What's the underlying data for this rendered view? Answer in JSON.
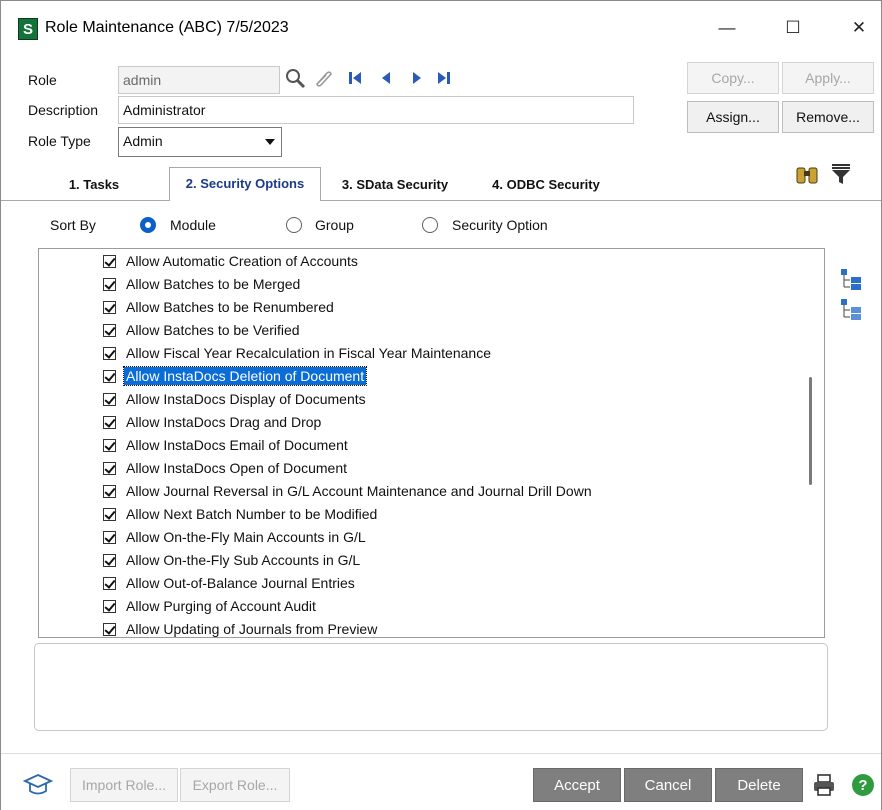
{
  "window": {
    "logo_letter": "S",
    "title": "Role Maintenance (ABC) 7/5/2023",
    "minimize": "—",
    "maximize": "☐",
    "close": "✕"
  },
  "form": {
    "role_label": "Role",
    "role_value": "admin",
    "description_label": "Description",
    "description_value": "Administrator",
    "role_type_label": "Role Type",
    "role_type_value": "Admin"
  },
  "buttons": {
    "copy": "Copy...",
    "apply": "Apply...",
    "assign": "Assign...",
    "remove": "Remove..."
  },
  "tabs": [
    {
      "label": "1. Tasks",
      "active": false
    },
    {
      "label": "2. Security Options",
      "active": true
    },
    {
      "label": "3. SData Security",
      "active": false
    },
    {
      "label": "4. ODBC Security",
      "active": false
    }
  ],
  "sort_by": {
    "label": "Sort By",
    "options": [
      "Module",
      "Group",
      "Security Option"
    ],
    "selected": "Module"
  },
  "security_options": [
    {
      "label": "Allow Automatic Creation of Accounts",
      "checked": true,
      "selected": false
    },
    {
      "label": "Allow Batches to be Merged",
      "checked": true,
      "selected": false
    },
    {
      "label": "Allow Batches to be Renumbered",
      "checked": true,
      "selected": false
    },
    {
      "label": "Allow Batches to be Verified",
      "checked": true,
      "selected": false
    },
    {
      "label": "Allow Fiscal Year Recalculation in Fiscal Year Maintenance",
      "checked": true,
      "selected": false
    },
    {
      "label": "Allow InstaDocs Deletion of Document",
      "checked": true,
      "selected": true
    },
    {
      "label": "Allow InstaDocs Display of Documents",
      "checked": true,
      "selected": false
    },
    {
      "label": "Allow InstaDocs Drag and Drop",
      "checked": true,
      "selected": false
    },
    {
      "label": "Allow InstaDocs Email of Document",
      "checked": true,
      "selected": false
    },
    {
      "label": "Allow InstaDocs Open of Document",
      "checked": true,
      "selected": false
    },
    {
      "label": "Allow Journal Reversal in G/L Account Maintenance and Journal Drill Down",
      "checked": true,
      "selected": false
    },
    {
      "label": "Allow Next Batch Number to be Modified",
      "checked": true,
      "selected": false
    },
    {
      "label": "Allow On-the-Fly Main Accounts in G/L",
      "checked": true,
      "selected": false
    },
    {
      "label": "Allow On-the-Fly Sub Accounts in G/L",
      "checked": true,
      "selected": false
    },
    {
      "label": "Allow Out-of-Balance Journal Entries",
      "checked": true,
      "selected": false
    },
    {
      "label": "Allow Purging of Account Audit",
      "checked": true,
      "selected": false
    },
    {
      "label": "Allow Updating of Journals from Preview",
      "checked": true,
      "selected": false
    }
  ],
  "footer": {
    "import_role": "Import Role...",
    "export_role": "Export Role...",
    "accept": "Accept",
    "cancel": "Cancel",
    "delete": "Delete"
  },
  "colors": {
    "accent": "#0a6cd6",
    "logo_green": "#13733a",
    "dark_button": "#7f7f7f"
  }
}
